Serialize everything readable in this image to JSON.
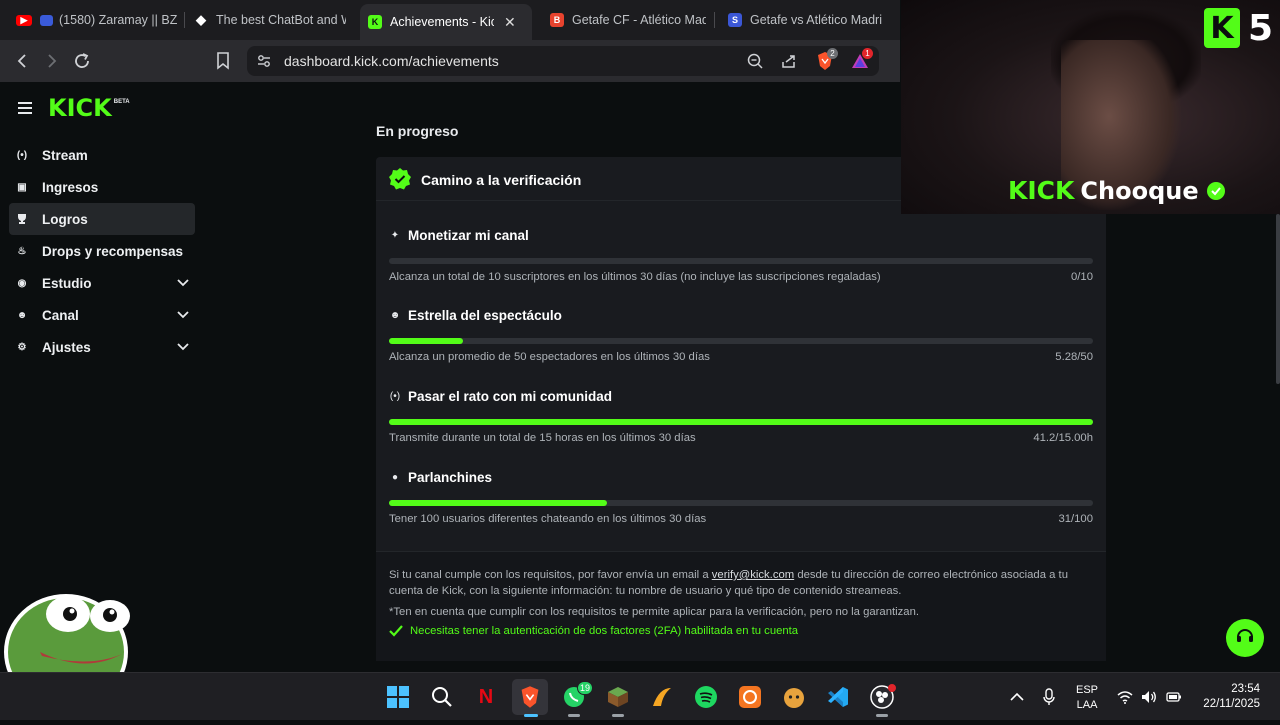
{
  "browser": {
    "tabs": [
      {
        "title": "(1580) Zaramay || BZ",
        "favicon_color": "#ff0000",
        "active": false
      },
      {
        "title": "The best ChatBot and W",
        "favicon_color": "#ffffff",
        "active": false
      },
      {
        "title": "Achievements - Kick",
        "favicon_color": "#53fc18",
        "active": true
      },
      {
        "title": "Getafe CF - Atlético Mad",
        "favicon_color": "#e8432e",
        "active": false
      },
      {
        "title": "Getafe vs Atlético Madri",
        "favicon_color": "#3b57d6",
        "active": false
      }
    ],
    "url": "dashboard.kick.com/achievements",
    "brave_badge": "2",
    "alerts_badge": "1"
  },
  "sidebar": {
    "logo": "KICK",
    "logo_badge": "BETA",
    "items": [
      {
        "label": "Stream",
        "icon": "broadcast-icon",
        "glyph": "(•)",
        "expandable": false,
        "active": false
      },
      {
        "label": "Ingresos",
        "icon": "chart-icon",
        "glyph": "▣",
        "expandable": false,
        "active": false
      },
      {
        "label": "Logros",
        "icon": "trophy-icon",
        "glyph": "🏆",
        "expandable": false,
        "active": true
      },
      {
        "label": "Drops y recompensas",
        "icon": "gift-icon",
        "glyph": "♨",
        "expandable": false,
        "active": false
      },
      {
        "label": "Estudio",
        "icon": "studio-icon",
        "glyph": "◉",
        "expandable": true,
        "active": false
      },
      {
        "label": "Canal",
        "icon": "users-icon",
        "glyph": "☻",
        "expandable": true,
        "active": false
      },
      {
        "label": "Ajustes",
        "icon": "gear-icon",
        "glyph": "⚙",
        "expandable": true,
        "active": false
      }
    ]
  },
  "main": {
    "section_title": "En progreso",
    "card_title": "Camino a la verificación",
    "goals": [
      {
        "title": "Monetizar mi canal",
        "icon": "sparkle-icon",
        "glyph": "✦",
        "description": "Alcanza un total de 10 suscriptores en los últimos 30 días (no incluye las suscripciones regaladas)",
        "value": "0/10",
        "progress": 0.0
      },
      {
        "title": "Estrella del espectáculo",
        "icon": "viewers-icon",
        "glyph": "☻",
        "description": "Alcanza un promedio de 50 espectadores en los últimos 30 días",
        "value": "5.28/50",
        "progress": 0.1056
      },
      {
        "title": "Pasar el rato con mi comunidad",
        "icon": "broadcast-icon",
        "glyph": "(•)",
        "description": "Transmite durante un total de 15 horas en los últimos 30 días",
        "value": "41.2/15.00h",
        "progress": 1.0
      },
      {
        "title": "Parlanchines",
        "icon": "chat-icon",
        "glyph": "●",
        "description": "Tener 100 usuarios diferentes chateando en los últimos 30 días",
        "value": "31/100",
        "progress": 0.31
      }
    ],
    "info_text_before": "Si tu canal cumple con los requisitos, por favor envía un email a",
    "info_email": "verify@kick.com",
    "info_text_after": "desde tu dirección de correo electrónico asociada a tu cuenta de Kick, con la siguiente información: tu nombre de usuario y qué tipo de contenido streameas.",
    "disclaimer": "*Ten en cuenta que cumplir con los requisitos te permite aplicar para la verificación, pero no la garantizan.",
    "twofa_notice": "Necesitas tener la autenticación de dos factores (2FA) habilitada en tu cuenta"
  },
  "overlay": {
    "corner_logo_letter": "K",
    "corner_number": "5",
    "streamer_prefix": "KICK",
    "streamer_name": "Chooque"
  },
  "taskbar": {
    "whatsapp_badge": "19",
    "language": "ESP",
    "layout": "LAA",
    "time": "23:54",
    "date": "22/11/2025"
  },
  "colors": {
    "accent": "#53fc18",
    "card_bg": "#191b1f",
    "page_bg": "#0b0e0f"
  }
}
